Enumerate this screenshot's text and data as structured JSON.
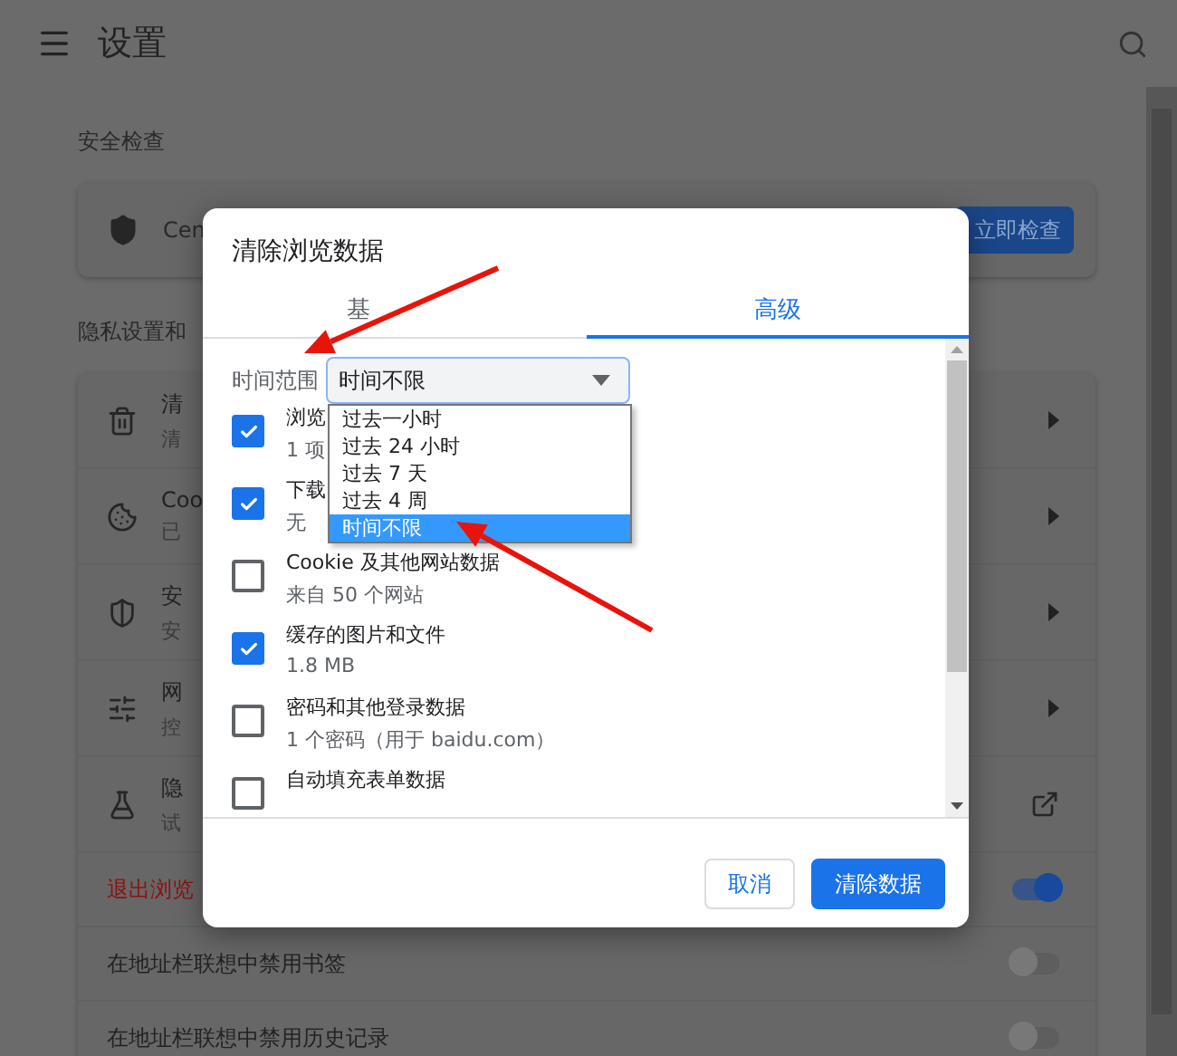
{
  "header": {
    "title": "设置"
  },
  "safety": {
    "heading": "安全检查",
    "text": "Cen",
    "button": "立即检查"
  },
  "privacy": {
    "heading": "隐私设置和",
    "rows": [
      {
        "title": "清",
        "subtitle": "清",
        "kind": "submenu"
      },
      {
        "title": "Coo",
        "subtitle": "已",
        "kind": "submenu"
      },
      {
        "title": "安",
        "subtitle": "安",
        "kind": "submenu"
      },
      {
        "title": "网",
        "subtitle": "控",
        "kind": "submenu"
      },
      {
        "title": "隐",
        "subtitle": "试",
        "kind": "external"
      }
    ],
    "toggles": [
      {
        "label": "退出浏览",
        "on": true,
        "warning": true
      },
      {
        "label": "在地址栏联想中禁用书签",
        "on": false,
        "warning": false
      },
      {
        "label": "在地址栏联想中禁用历史记录",
        "on": false,
        "warning": false
      }
    ]
  },
  "dialog": {
    "title": "清除浏览数据",
    "tabs": [
      {
        "label": "基",
        "selected": false
      },
      {
        "label": "高级",
        "selected": true
      }
    ],
    "time_range": {
      "label": "时间范围",
      "value": "时间不限",
      "expanded": true,
      "options": [
        {
          "label": "过去一小时",
          "selected": false
        },
        {
          "label": "过去 24 小时",
          "selected": false
        },
        {
          "label": "过去 7 天",
          "selected": false
        },
        {
          "label": "过去 4 周",
          "selected": false
        },
        {
          "label": "时间不限",
          "selected": true
        }
      ]
    },
    "items": [
      {
        "title": "浏览",
        "subtitle": "1 项",
        "checked": true
      },
      {
        "title": "下载",
        "subtitle": "无",
        "checked": true
      },
      {
        "title": "Cookie 及其他网站数据",
        "subtitle": "来自 50 个网站",
        "checked": false
      },
      {
        "title": "缓存的图片和文件",
        "subtitle": "1.8 MB",
        "checked": true
      },
      {
        "title": "密码和其他登录数据",
        "subtitle": "1 个密码（用于 baidu.com）",
        "checked": false
      },
      {
        "title": "自动填充表单数据",
        "checked": false
      }
    ],
    "buttons": [
      {
        "label": "取消",
        "kind": "secondary"
      },
      {
        "label": "清除数据",
        "kind": "primary"
      }
    ]
  },
  "annotations": [
    {
      "kind": "arrow"
    },
    {
      "kind": "arrow"
    }
  ]
}
